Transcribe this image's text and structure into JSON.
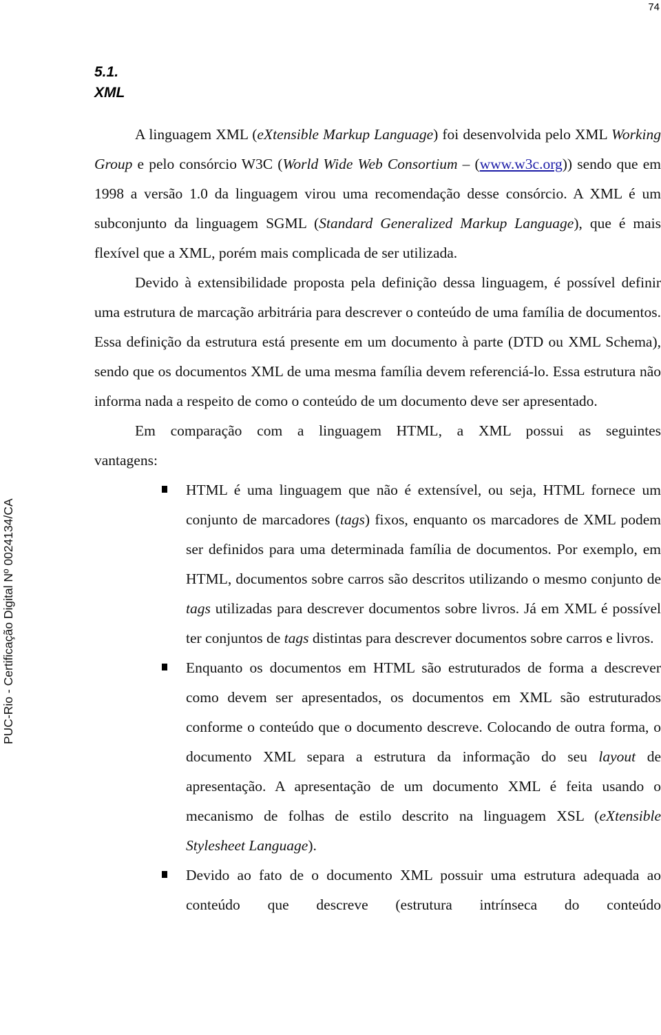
{
  "page": {
    "number": "74",
    "watermark": "PUC-Rio - Certificação Digital Nº 0024134/CA"
  },
  "section": {
    "number": "5.1.",
    "title": "XML"
  },
  "paragraphs": {
    "p1": {
      "s1": "A linguagem XML (",
      "i1": "eXtensible Markup Language",
      "s2": ") foi desenvolvida pelo XML ",
      "i2": "Working Group",
      "s3": " e pelo consórcio W3C (",
      "i3": "World Wide Web Consortium –",
      "s4": " (",
      "link": "www.w3c.org",
      "s5": ")) sendo que em 1998 a versão 1.0 da linguagem virou uma recomendação desse consórcio. A XML é um subconjunto da linguagem SGML (",
      "i4": "Standard Generalized Markup Language",
      "s6": "), que é mais flexível que a XML, porém mais complicada de ser utilizada."
    },
    "p2": "Devido à extensibilidade proposta pela definição dessa linguagem, é possível definir uma estrutura de marcação arbitrária para descrever o conteúdo de uma família de documentos. Essa definição da estrutura está presente em um documento à parte (DTD ou XML Schema), sendo que os documentos XML de uma mesma família devem referenciá-lo. Essa estrutura não informa nada a respeito de como o conteúdo de um documento deve ser apresentado.",
    "p3a": "Em comparação com a linguagem HTML, a XML possui as seguintes",
    "p3b": "vantagens:"
  },
  "advantages": [
    {
      "s1": "HTML é uma linguagem que não é extensível, ou seja, HTML fornece um conjunto de marcadores (",
      "i1": "tags",
      "s2": ") fixos, enquanto os marcadores de XML podem ser definidos para uma determinada família de documentos. Por exemplo, em HTML, documentos sobre carros são descritos utilizando o mesmo conjunto de ",
      "i2": "tags",
      "s3": " utilizadas para descrever documentos sobre livros. Já em XML é possível ter conjuntos de ",
      "i3": "tags",
      "s4": " distintas para descrever documentos sobre carros e livros."
    },
    {
      "s1": "Enquanto os documentos em HTML são estruturados de forma a descrever como devem ser apresentados, os documentos em XML são estruturados conforme o conteúdo que o documento descreve. Colocando de outra forma, o documento XML separa a estrutura da informação do seu ",
      "i1": "layout",
      "s2": " de apresentação. A apresentação de um documento XML é feita usando o mecanismo de folhas de estilo descrito na linguagem XSL (",
      "i2": "eXtensible Stylesheet Language",
      "s3": ")."
    },
    {
      "s1": "Devido ao fato de o documento XML possuir uma estrutura adequada ao conteúdo que descreve (estrutura intrínseca do conteúdo"
    }
  ]
}
